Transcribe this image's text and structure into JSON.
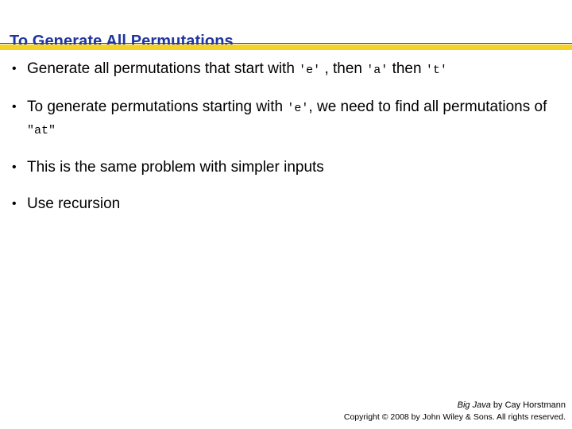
{
  "slide": {
    "title": "To Generate All Permutations",
    "accent_colors": {
      "title_blue": "#1f35a0",
      "divider_yellow": "#f5d227",
      "divider_rule": "#24379b",
      "background": "#ffffff",
      "body_text": "#000000"
    },
    "bullet_marker": "•",
    "bullets": [
      {
        "id": "bullet-generate-start",
        "parts": [
          {
            "type": "text",
            "value": "Generate all permutations that start with "
          },
          {
            "type": "code",
            "value": "'e'"
          },
          {
            "type": "text",
            "value": " , then "
          },
          {
            "type": "code",
            "value": "'a'"
          },
          {
            "type": "text",
            "value": " then "
          },
          {
            "type": "code",
            "value": "'t'"
          }
        ]
      },
      {
        "id": "bullet-starting-with-e",
        "parts": [
          {
            "type": "text",
            "value": "To generate permutations starting with "
          },
          {
            "type": "code",
            "value": "'e'"
          },
          {
            "type": "text",
            "value": ", we need to find all permutations of "
          },
          {
            "type": "code",
            "value": "\"at\""
          }
        ]
      },
      {
        "id": "bullet-same-problem",
        "parts": [
          {
            "type": "text",
            "value": "This is the same problem with simpler inputs"
          }
        ]
      },
      {
        "id": "bullet-use-recursion",
        "parts": [
          {
            "type": "text",
            "value": "Use recursion"
          }
        ]
      }
    ]
  },
  "footer": {
    "book_title": "Big Java",
    "credit_suffix": " by Cay Horstmann",
    "copyright": "Copyright © 2008 by John Wiley & Sons.  All rights reserved."
  }
}
